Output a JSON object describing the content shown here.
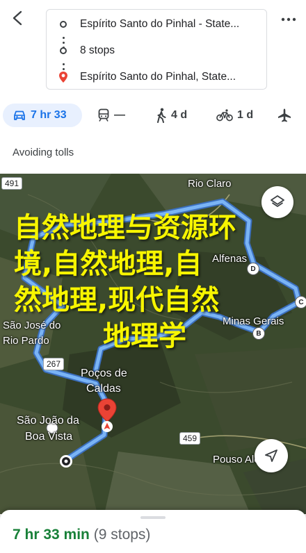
{
  "header": {
    "origin": "Espírito Santo do Pinhal - State...",
    "stops": "8 stops",
    "destination": "Espírito Santo do Pinhal, State..."
  },
  "modes": [
    {
      "name": "drive",
      "label": "7 hr 33",
      "active": true
    },
    {
      "name": "transit",
      "label": "—",
      "active": false
    },
    {
      "name": "walk",
      "label": "4 d",
      "active": false
    },
    {
      "name": "bike",
      "label": "1 d",
      "active": false
    },
    {
      "name": "flight",
      "label": "",
      "active": false
    }
  ],
  "route_option": "Avoiding tolls",
  "map": {
    "places": [
      "Rio Claro",
      "Alfenas",
      "São José do",
      "Rio Pardo",
      "Poços de",
      "Caldas",
      "São João da",
      "Boa Vista",
      "Minas Gerais",
      "Pouso Alegre"
    ],
    "road_badges": [
      "491",
      "267",
      "459"
    ],
    "stop_markers": [
      "D",
      "B",
      "C"
    ],
    "overlay_lines": [
      "自然地理与资源环",
      "境,自然地理,自",
      "然地理,现代自然",
      "地理学"
    ],
    "colors": {
      "route": "#7ab4f5",
      "overlay": "#f7f500"
    }
  },
  "sheet": {
    "duration": "7 hr 33 min",
    "stops": "(9 stops)"
  }
}
